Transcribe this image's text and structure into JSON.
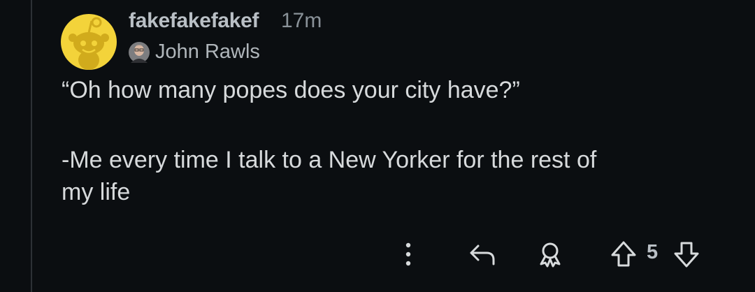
{
  "comment": {
    "username": "fakefakefakef",
    "timestamp": "17m",
    "flair": "John Rawls",
    "body_lines": [
      "“Oh how many popes does your city have?”",
      "-Me every time I talk to a New Yorker for the rest of",
      "my life"
    ]
  },
  "actions": {
    "more_icon": "more-vertical-icon",
    "reply_icon": "reply-icon",
    "award_icon": "award-icon",
    "upvote_icon": "upvote-arrow-icon",
    "vote_count": "5",
    "downvote_icon": "downvote-arrow-icon"
  },
  "colors": {
    "background": "#0b0e11",
    "text": "#d7dadc",
    "muted": "#8a9299",
    "avatar_bg": "#f3d33a"
  }
}
